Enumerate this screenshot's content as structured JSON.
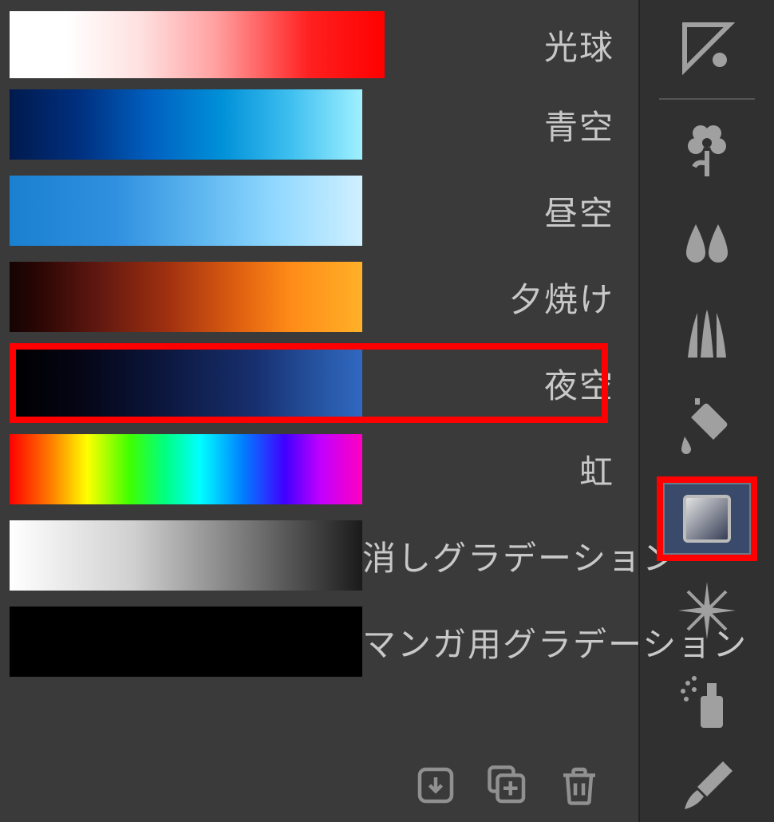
{
  "gradients": [
    {
      "id": "lightball",
      "label": "光球",
      "first": true
    },
    {
      "id": "bluesky",
      "label": "青空"
    },
    {
      "id": "daysky",
      "label": "昼空"
    },
    {
      "id": "sunset",
      "label": "夕焼け"
    },
    {
      "id": "nightsky",
      "label": "夜空",
      "highlighted": true
    },
    {
      "id": "rainbow",
      "label": "虹"
    },
    {
      "id": "erase",
      "label": "消しグラデーション"
    },
    {
      "id": "manga",
      "label": "マンガ用グラデーション"
    }
  ],
  "footer": {
    "import_icon": "import",
    "duplicate_icon": "duplicate",
    "trash_icon": "trash"
  },
  "tools": [
    {
      "name": "triangle-tool-icon"
    },
    {
      "name": "flower-tool-icon"
    },
    {
      "name": "blur-tool-icon"
    },
    {
      "name": "grass-tool-icon"
    },
    {
      "name": "bucket-tool-icon"
    },
    {
      "name": "gradient-tool-icon",
      "selected": true,
      "highlighted": true
    },
    {
      "name": "sparkle-tool-icon"
    },
    {
      "name": "spray-tool-icon"
    },
    {
      "name": "brush-tool-icon"
    }
  ],
  "colors": {
    "highlight": "#ff0000",
    "panel_bg": "#3a3a3a",
    "tool_bg": "#303030",
    "text": "#c8c8c8"
  }
}
